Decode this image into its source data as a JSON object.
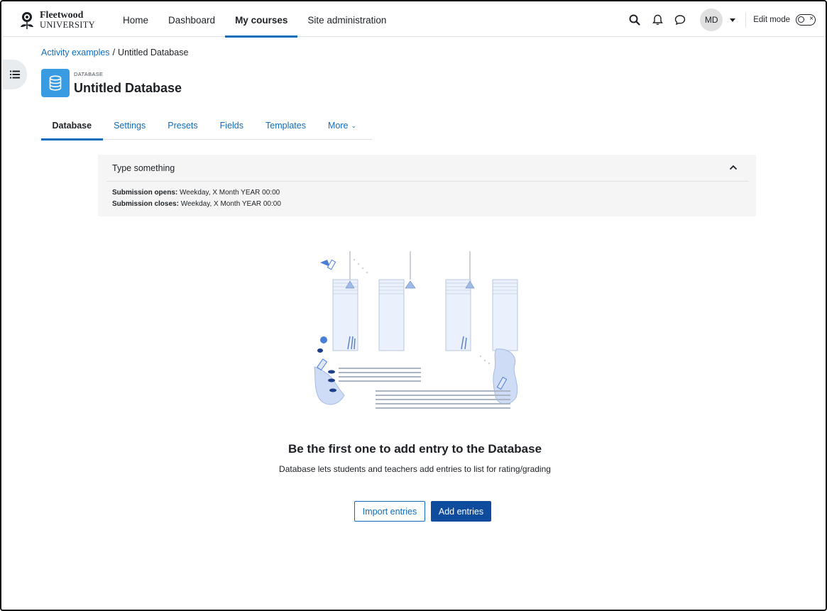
{
  "navbar": {
    "logo": {
      "line1": "Fleetwood",
      "line2": "UNIVERSITY"
    },
    "links": [
      {
        "label": "Home",
        "active": false
      },
      {
        "label": "Dashboard",
        "active": false
      },
      {
        "label": "My courses",
        "active": true
      },
      {
        "label": "Site administration",
        "active": false
      }
    ],
    "icons": [
      "search-icon",
      "bell-icon",
      "chat-icon"
    ],
    "avatar_initials": "MD",
    "edit_mode_label": "Edit mode"
  },
  "breadcrumb": {
    "parent": "Activity examples",
    "separator": "/",
    "current": "Untitled Database"
  },
  "header": {
    "module_type": "DATABASE",
    "title": "Untitled Database",
    "icon": "database-icon",
    "icon_color": "#399be2"
  },
  "tabs": [
    {
      "label": "Database",
      "active": true
    },
    {
      "label": "Settings",
      "active": false
    },
    {
      "label": "Presets",
      "active": false
    },
    {
      "label": "Fields",
      "active": false
    },
    {
      "label": "Templates",
      "active": false
    },
    {
      "label": "More",
      "active": false,
      "dropdown": true
    }
  ],
  "info_panel": {
    "heading": "Type something",
    "opens_label": "Submission opens:",
    "opens_value": "Weekday, X Month YEAR 00:00",
    "closes_label": "Submission closes:",
    "closes_value": "Weekday, X Month YEAR 00:00"
  },
  "empty_state": {
    "title": "Be the first one to add entry to the Database",
    "description": "Database lets students and teachers add entries to list for rating/grading"
  },
  "buttons": {
    "import_label": "Import entries",
    "add_label": "Add entries"
  },
  "colors": {
    "accent": "#0f6cbf",
    "primary_button": "#0f4c9d",
    "panel_bg": "#f5f5f5",
    "illustration": "#4a7fd8"
  }
}
